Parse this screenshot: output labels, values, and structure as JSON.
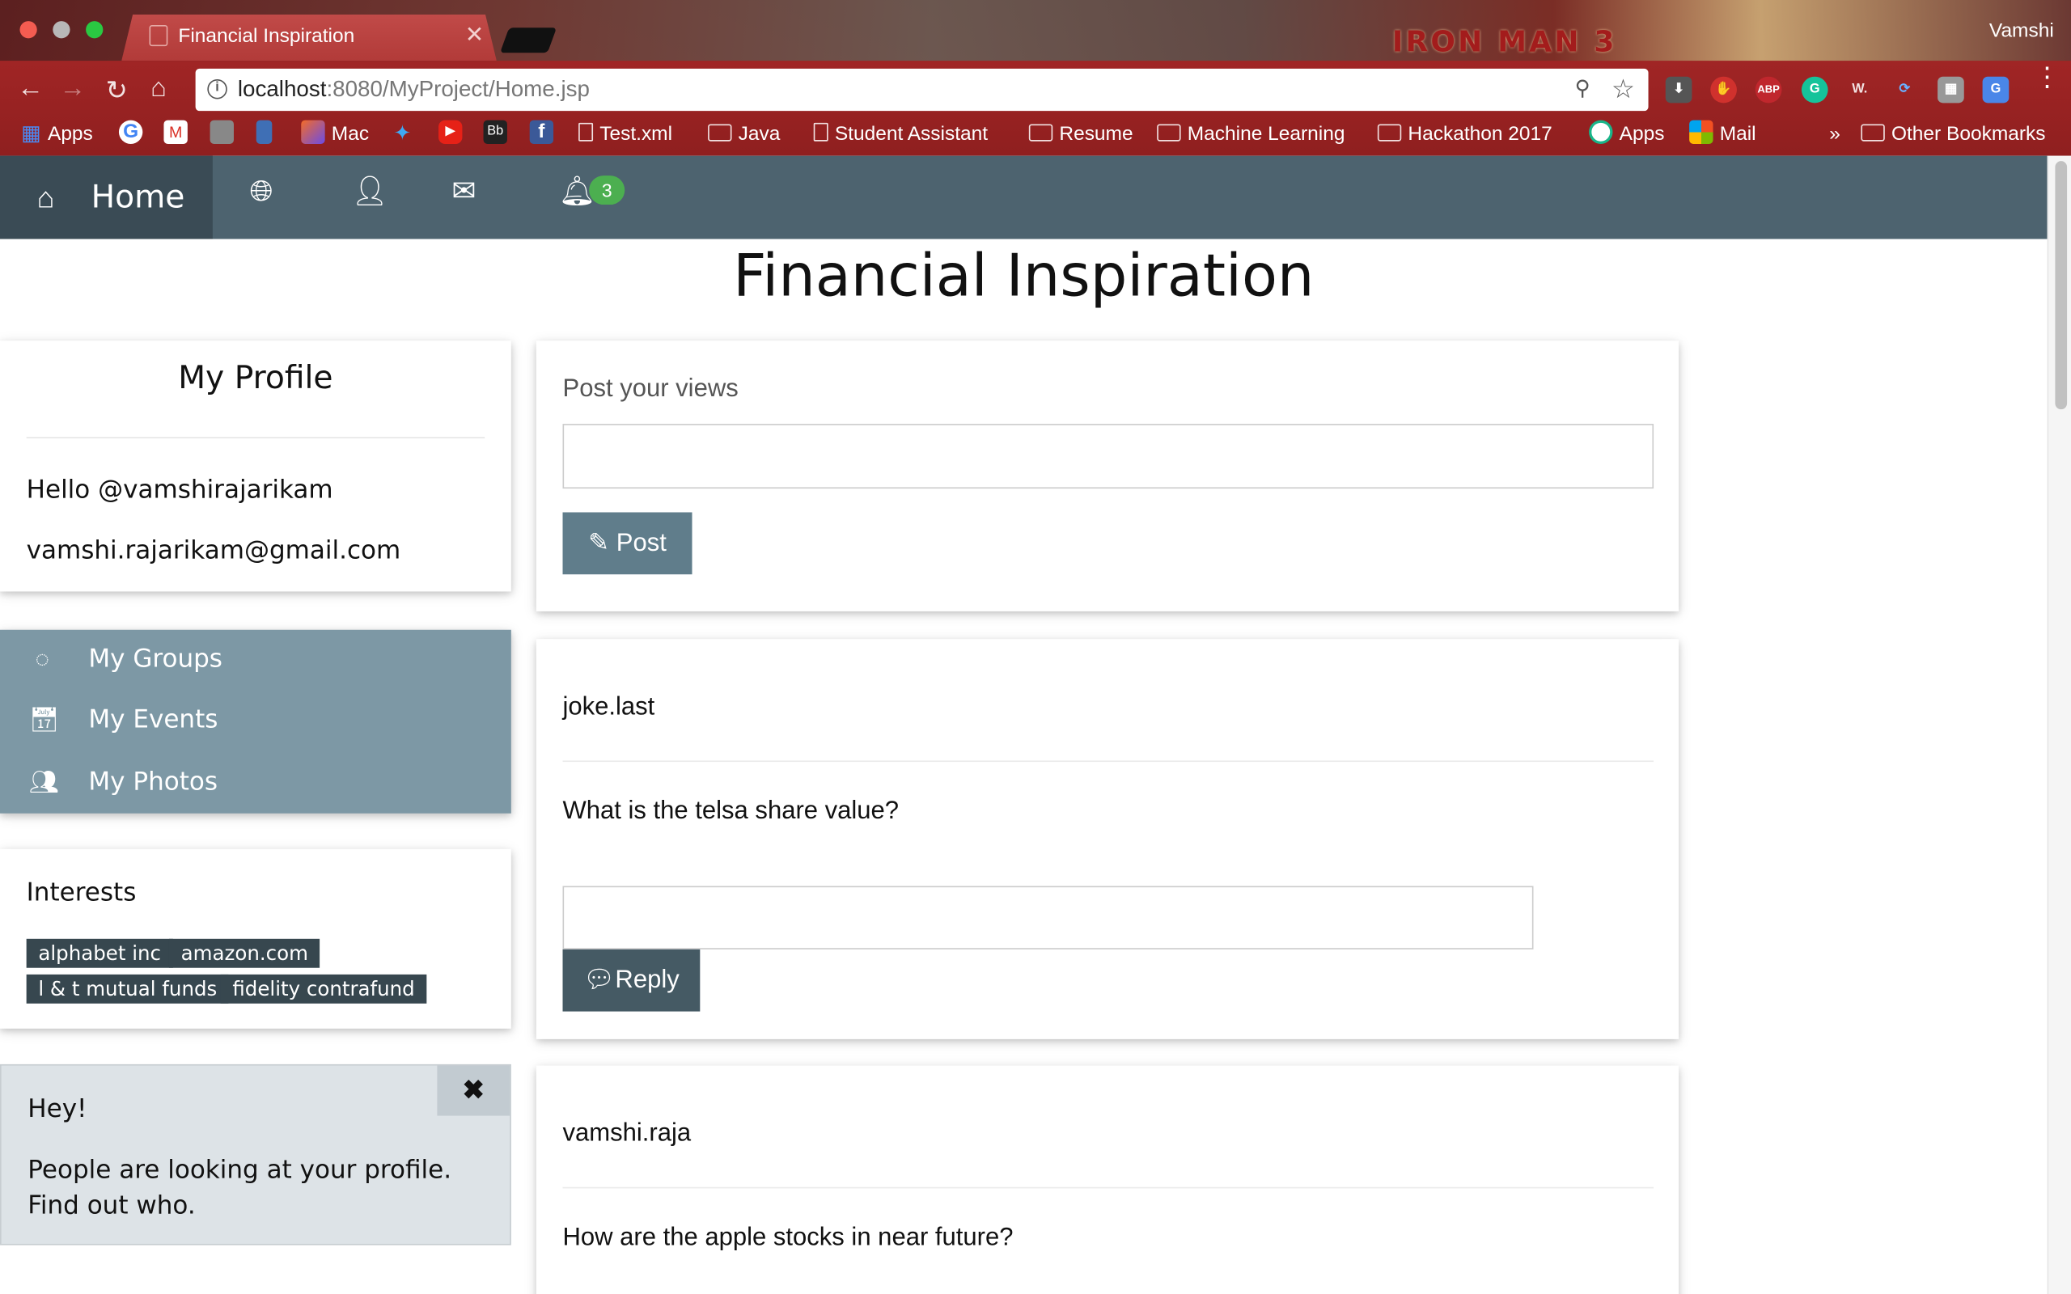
{
  "browser": {
    "tab_title": "Financial Inspiration",
    "profile_name": "Vamshi",
    "theme_text": "IRON MAN 3",
    "url_host": "localhost",
    "url_rest": ":8080/MyProject/Home.jsp",
    "bookmarks": {
      "apps": "Apps",
      "mac": "Mac",
      "test_xml": "Test.xml",
      "java": "Java",
      "student_assistant": "Student Assistant",
      "resume": "Resume",
      "machine_learning": "Machine Learning",
      "hackathon": "Hackathon 2017",
      "apps2": "Apps",
      "mail": "Mail",
      "more": "»",
      "other": "Other Bookmarks"
    },
    "extensions": {
      "abp": "ABP",
      "grammarly": "G",
      "w": "W."
    }
  },
  "nav": {
    "home_label": "Home",
    "notification_count": "3"
  },
  "page": {
    "title": "Financial Inspiration"
  },
  "profile": {
    "title": "My Profile",
    "greeting": "Hello @vamshirajarikam",
    "email": "vamshi.rajarikam@gmail.com"
  },
  "menu": {
    "groups": "My Groups",
    "events": "My Events",
    "photos": "My Photos"
  },
  "interests": {
    "title": "Interests",
    "tags": [
      "alphabet inc",
      "amazon.com",
      "l & t mutual funds",
      "fidelity contrafund"
    ]
  },
  "alert": {
    "title": "Hey!",
    "text": "People are looking at your profile. Find out who."
  },
  "composer": {
    "label": "Post your views",
    "input_value": "",
    "button": "Post"
  },
  "feed": [
    {
      "user": "joke.last",
      "text": "What is the telsa share value?",
      "reply_button": "Reply"
    },
    {
      "user": "vamshi.raja",
      "text": "How are the apple stocks in near future?"
    }
  ],
  "colors": {
    "navbar": "#4d636f",
    "navbar_active": "#3a4b55",
    "sidebar_menu": "#7d98a5",
    "tag": "#37474f",
    "post_button": "#607d8b",
    "reply_button": "#455a64",
    "badge": "#4caf50"
  }
}
